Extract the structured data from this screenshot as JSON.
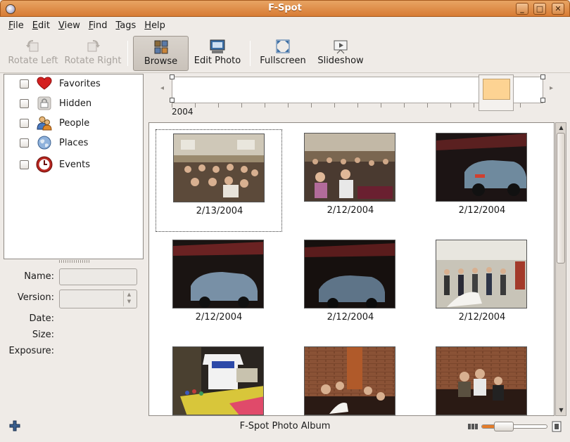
{
  "window": {
    "title": "F-Spot"
  },
  "menu": [
    "File",
    "Edit",
    "View",
    "Find",
    "Tags",
    "Help"
  ],
  "toolbar": {
    "rotate_left": "Rotate Left",
    "rotate_right": "Rotate Right",
    "browse": "Browse",
    "edit_photo": "Edit Photo",
    "fullscreen": "Fullscreen",
    "slideshow": "Slideshow"
  },
  "tags": [
    {
      "label": "Favorites",
      "icon": "heart-icon"
    },
    {
      "label": "Hidden",
      "icon": "lock-icon"
    },
    {
      "label": "People",
      "icon": "people-icon"
    },
    {
      "label": "Places",
      "icon": "globe-icon"
    },
    {
      "label": "Events",
      "icon": "clock-icon"
    }
  ],
  "info": {
    "name_label": "Name:",
    "version_label": "Version:",
    "date_label": "Date:",
    "size_label": "Size:",
    "exposure_label": "Exposure:"
  },
  "timeline": {
    "year": "2004"
  },
  "photos": [
    {
      "date": "2/13/2004"
    },
    {
      "date": "2/12/2004"
    },
    {
      "date": "2/12/2004"
    },
    {
      "date": "2/12/2004"
    },
    {
      "date": "2/12/2004"
    },
    {
      "date": "2/12/2004"
    },
    {
      "date": ""
    },
    {
      "date": ""
    },
    {
      "date": ""
    }
  ],
  "status": {
    "text": "F-Spot Photo Album"
  },
  "zoom": {
    "level": 0.25
  },
  "colors": {
    "titlebar": "#d77b34",
    "accent": "#e67c28"
  }
}
